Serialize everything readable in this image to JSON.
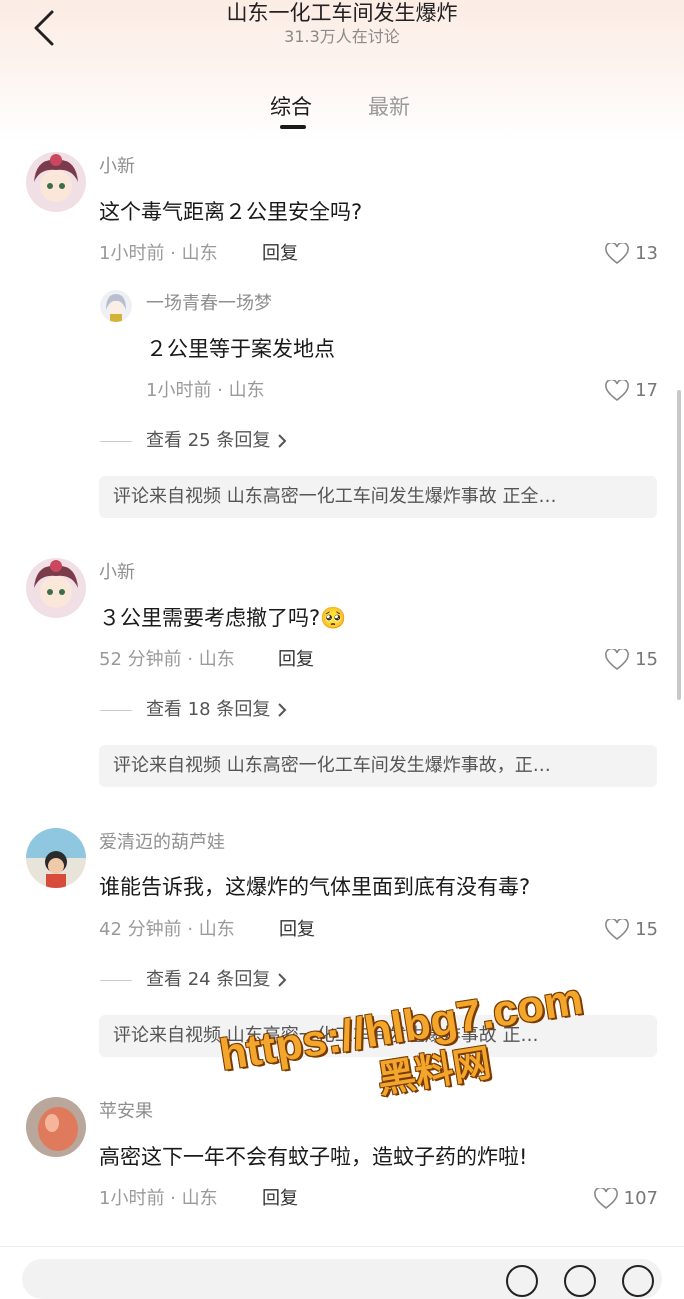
{
  "header": {
    "title": "山东一化工车间发生爆炸",
    "subtitle": "31.3万人在讨论"
  },
  "tabs": {
    "active": "综合",
    "inactive": "最新"
  },
  "comments": [
    {
      "user": "小新",
      "text": "这个毒气距离２公里安全吗?",
      "meta": "1小时前 · 山东",
      "reply_label": "回复",
      "likes": "13",
      "reply": {
        "user": "一场青春一场梦",
        "text": "２公里等于案发地点",
        "meta": "1小时前 · 山东",
        "likes": "17"
      },
      "more": "查看 25 条回复",
      "source_prefix": "评论来自视频",
      "source": " 山东高密一化工车间发生爆炸事故 正全…"
    },
    {
      "user": "小新",
      "text": "３公里需要考虑撤了吗?",
      "emoji": "🥺",
      "meta": "52 分钟前 · 山东",
      "reply_label": "回复",
      "likes": "15",
      "more": "查看 18 条回复",
      "source_prefix": "评论来自视频",
      "source": " 山东高密一化工车间发生爆炸事故，正…"
    },
    {
      "user": "爱清迈的葫芦娃",
      "text": "谁能告诉我，这爆炸的气体里面到底有没有毒?",
      "meta": "42 分钟前 · 山东",
      "reply_label": "回复",
      "likes": "15",
      "more": "查看 24 条回复",
      "source_prefix": "评论来自视频",
      "source": " 山东高密一化工车间发生爆炸事故 正…"
    },
    {
      "user": "苹安果",
      "text": "高密这下一年不会有蚊子啦，造蚊子药的炸啦!",
      "meta": "1小时前 · 山东",
      "reply_label": "回复",
      "likes": "107"
    }
  ],
  "watermark": {
    "url": "https://hlbg7.com",
    "name": "黑料网"
  },
  "icons": {
    "back": "back-chevron-icon",
    "like": "heart-outline-icon",
    "more": "chevron-right-icon"
  }
}
